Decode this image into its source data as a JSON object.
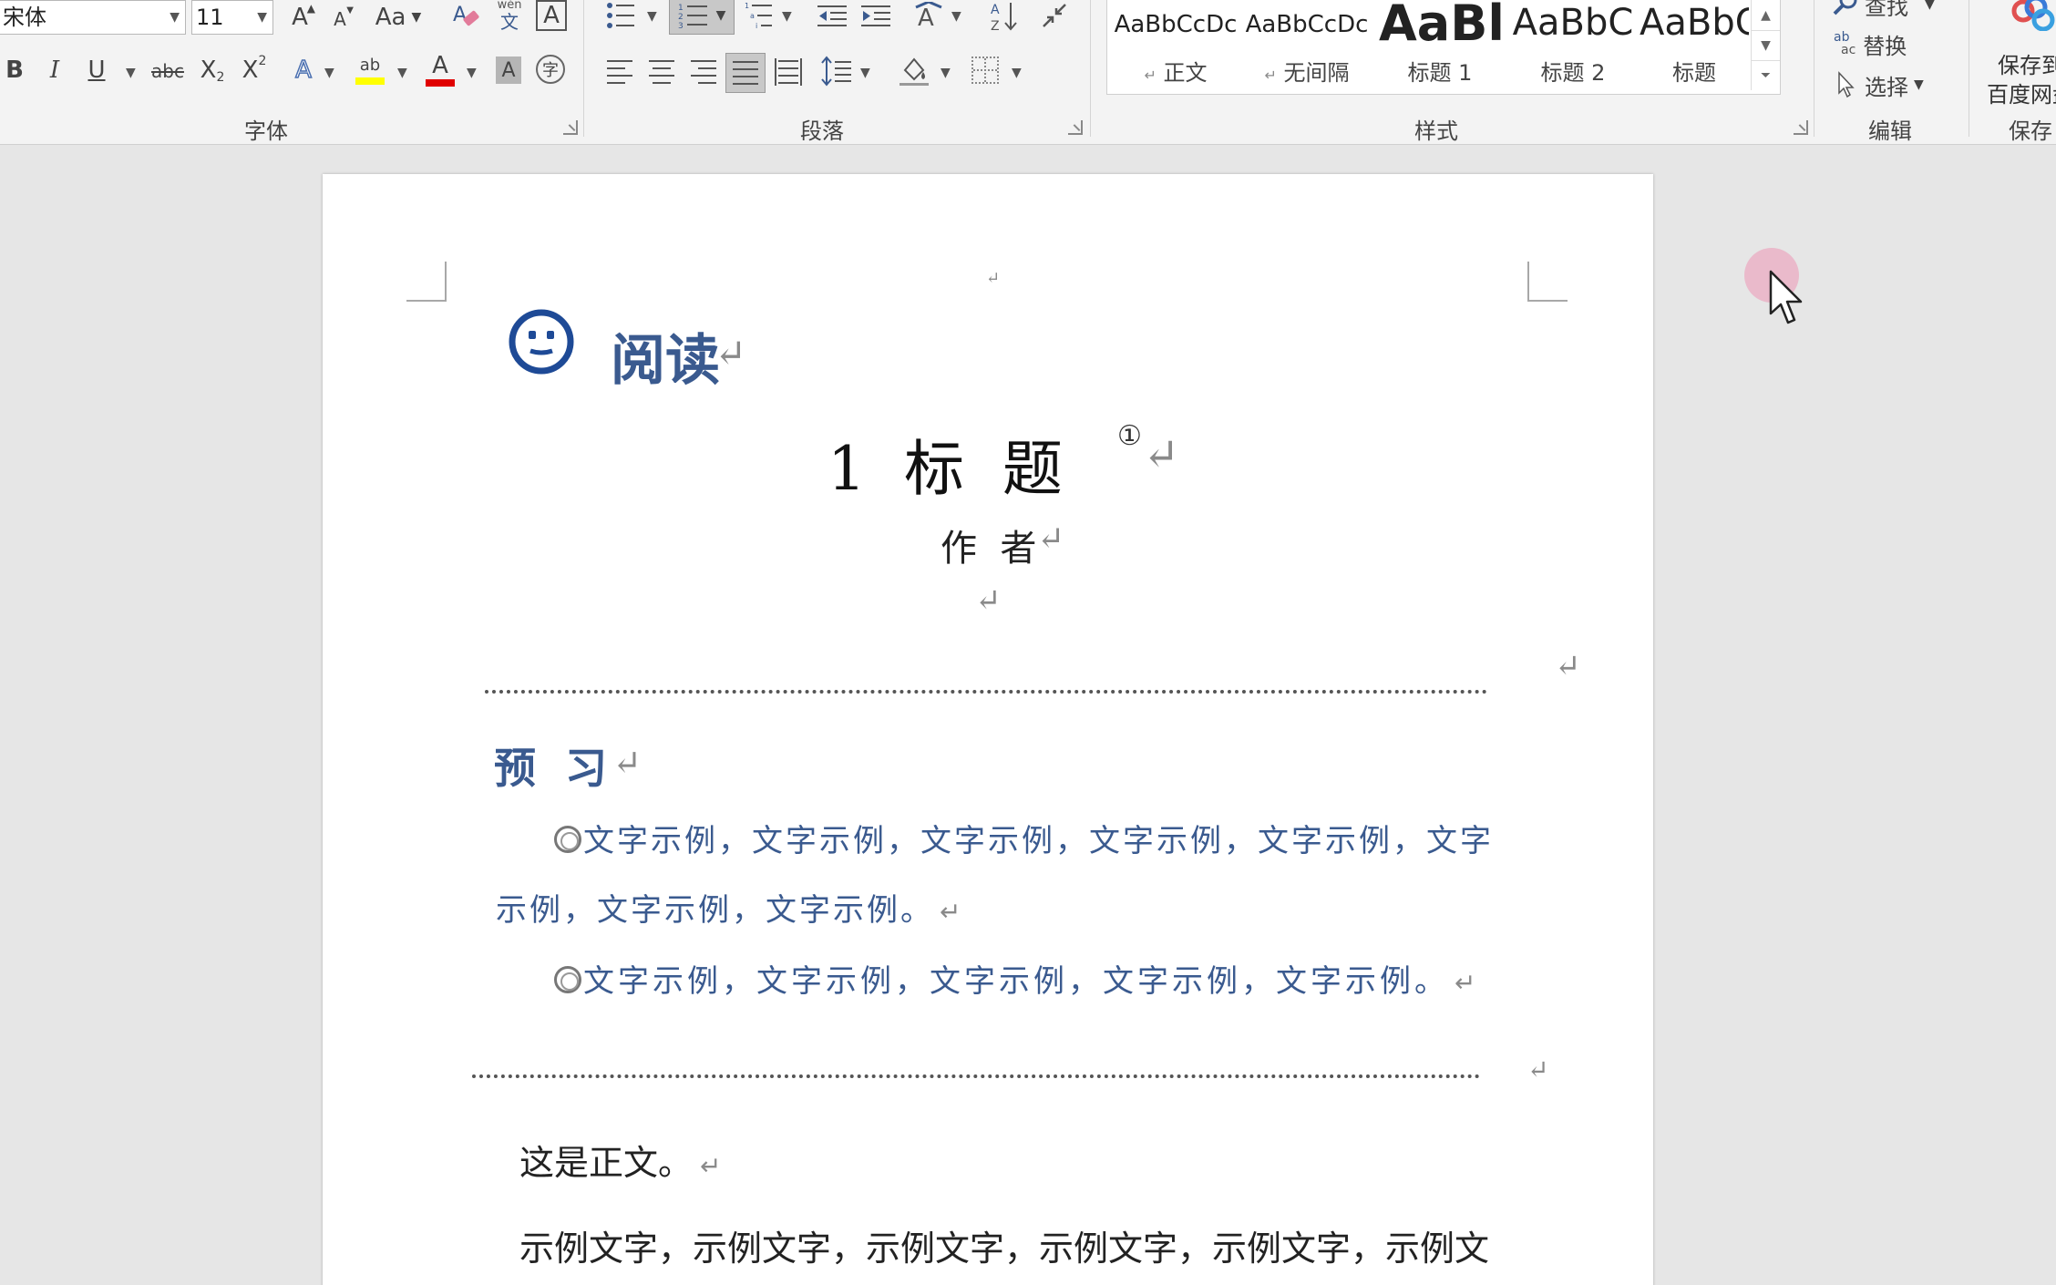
{
  "ribbon": {
    "font_group": {
      "label": "字体",
      "font_name": "宋体",
      "font_size": "11",
      "grow_font": "A",
      "shrink_font": "A",
      "change_case": "Aa",
      "phonetic_top": "wén",
      "phonetic_bottom": "文",
      "char_border": "A",
      "bold": "B",
      "italic": "I",
      "underline": "U",
      "strikethrough": "abc",
      "subscript": "X",
      "subscript_mark": "2",
      "superscript": "X",
      "superscript_mark": "2",
      "text_effects": "A",
      "highlight": "ab",
      "font_color": "A",
      "char_shading": "A",
      "enclose_char": "字"
    },
    "paragraph_group": {
      "label": "段落"
    },
    "styles_group": {
      "label": "样式",
      "styles": [
        {
          "preview": "AaBbCcDc",
          "name": "正文",
          "has_mark": true
        },
        {
          "preview": "AaBbCcDc",
          "name": "无间隔",
          "has_mark": true
        },
        {
          "preview": "AaBl",
          "name": "标题 1",
          "has_mark": false
        },
        {
          "preview": "AaBbC",
          "name": "标题 2",
          "has_mark": false
        },
        {
          "preview": "AaBbC",
          "name": "标题",
          "has_mark": false
        }
      ]
    },
    "editing_group": {
      "label": "编辑",
      "find": "查找",
      "replace": "替换",
      "select": "选择",
      "replace_icon_top": "ab",
      "replace_icon_bottom": "ac"
    },
    "save_group": {
      "label": "保存",
      "button_line1": "保存到",
      "button_line2": "百度网盘"
    }
  },
  "document": {
    "logo_text": "阅读",
    "title": "1  标  题",
    "title_note": "①",
    "author": "作  者",
    "section_heading": "预  习",
    "bullet1_line1": "文字示例，文字示例，文字示例，文字示例，文字示例，文字",
    "bullet1_line2": "示例，文字示例，文字示例。",
    "bullet2": "文字示例，文字示例，文字示例，文字示例，文字示例。",
    "body_line1": "这是正文。",
    "body_line2": "示例文字，示例文字，示例文字，示例文字，示例文字，示例文",
    "paragraph_mark": "↵"
  },
  "colors": {
    "accent_blue": "#3a5a8f",
    "highlight_yellow": "#ffff00",
    "font_red": "#e00000",
    "selected_button": "#c8c8c8"
  }
}
